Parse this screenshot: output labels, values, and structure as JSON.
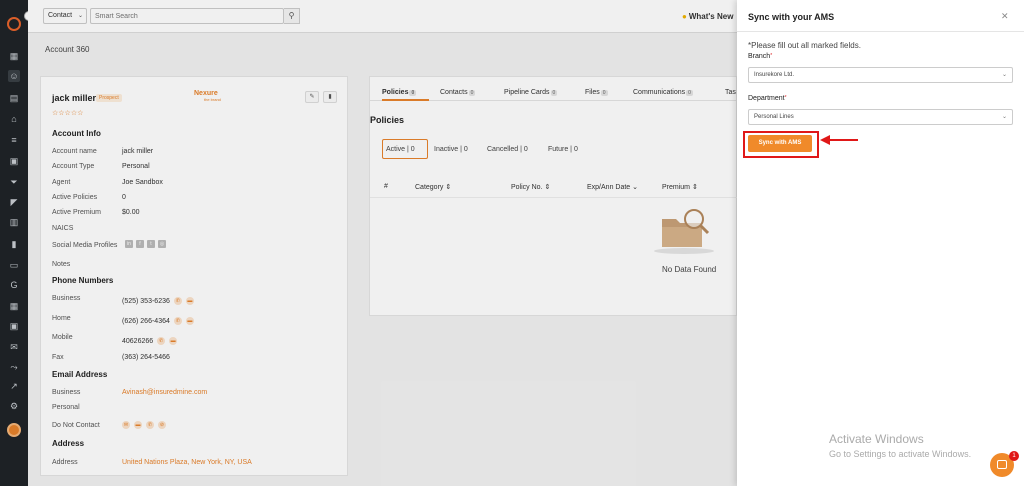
{
  "topbar": {
    "entity_select": "Contact",
    "search_placeholder": "Smart Search",
    "whats_new": "What's New"
  },
  "page": {
    "title": "Account 360"
  },
  "account": {
    "name": "jack miller",
    "badge": "Prospect",
    "stars": "☆☆☆☆☆",
    "logo_name": "Nexure",
    "logo_sub": "the brand",
    "account_info_heading": "Account Info",
    "fields": [
      {
        "label": "Account name",
        "value": "jack miller"
      },
      {
        "label": "Account Type",
        "value": "Personal"
      },
      {
        "label": "Agent",
        "value": "Joe Sandbox"
      },
      {
        "label": "Active Policies",
        "value": "0"
      },
      {
        "label": "Active Premium",
        "value": "$0.00"
      },
      {
        "label": "NAICS",
        "value": ""
      },
      {
        "label": "Social Media Profiles",
        "value": ""
      },
      {
        "label": "Notes",
        "value": ""
      }
    ],
    "phone_heading": "Phone Numbers",
    "phones": [
      {
        "label": "Business",
        "value": "(525) 353-6236"
      },
      {
        "label": "Home",
        "value": "(626) 266-4364"
      },
      {
        "label": "Mobile",
        "value": "40626266"
      },
      {
        "label": "Fax",
        "value": "(363) 264-5466"
      }
    ],
    "email_heading": "Email Address",
    "emails": [
      {
        "label": "Business",
        "value": "Avinash@insuredmine.com"
      },
      {
        "label": "Personal",
        "value": ""
      }
    ],
    "do_not_contact_label": "Do Not Contact",
    "address_heading": "Address",
    "address_label": "Address",
    "address_value": "United Nations Plaza, New York, NY, USA"
  },
  "policies": {
    "tabs": [
      {
        "label": "Policies",
        "count": "0"
      },
      {
        "label": "Contacts",
        "count": "0"
      },
      {
        "label": "Pipeline Cards",
        "count": "0"
      },
      {
        "label": "Files",
        "count": "0"
      },
      {
        "label": "Communications",
        "count": "0"
      },
      {
        "label": "Tas",
        "count": ""
      }
    ],
    "title": "Policies",
    "statuses": [
      {
        "label": "Active",
        "count": "0"
      },
      {
        "label": "Inactive",
        "count": "0"
      },
      {
        "label": "Cancelled",
        "count": "0"
      },
      {
        "label": "Future",
        "count": "0"
      }
    ],
    "columns": [
      "#",
      "Category ⇕",
      "Policy No. ⇕",
      "Exp/Ann Date ⌄",
      "Premium ⇕"
    ],
    "empty_text": "No Data Found"
  },
  "drawer": {
    "title": "Sync with your AMS",
    "note": "*Please fill out all marked fields.",
    "branch_label": "Branch",
    "branch_value": "Insurekore Ltd.",
    "department_label": "Department",
    "department_value": "Personal Lines",
    "sync_button": "Sync with AMS",
    "required_mark": "*"
  },
  "watermark": {
    "line1": "Activate Windows",
    "line2": "Go to Settings to activate Windows."
  },
  "chat": {
    "badge": "1"
  },
  "colors": {
    "accent": "#f08a2a",
    "highlight": "#e01818",
    "sidebar": "#1f2428"
  }
}
